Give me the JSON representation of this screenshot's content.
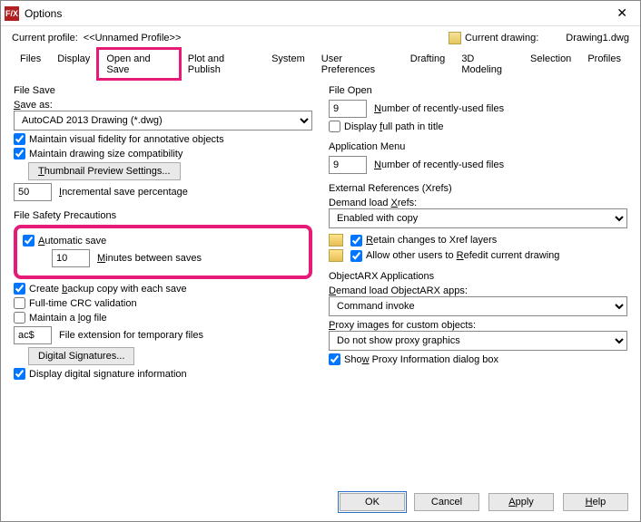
{
  "window": {
    "title": "Options",
    "appIcon": "F/X"
  },
  "profile": {
    "label": "Current profile:",
    "value": "<<Unnamed Profile>>",
    "drawingLabel": "Current drawing:",
    "drawingValue": "Drawing1.dwg"
  },
  "tabs": [
    "Files",
    "Display",
    "Open and Save",
    "Plot and Publish",
    "System",
    "User Preferences",
    "Drafting",
    "3D Modeling",
    "Selection",
    "Profiles"
  ],
  "activeTab": "Open and Save",
  "left": {
    "fileSave": {
      "title": "File Save",
      "saveAsLabel": "Save as:",
      "saveAsValue": "AutoCAD 2013 Drawing (*.dwg)",
      "maintainVisual": "Maintain visual fidelity for annotative objects",
      "maintainCompat": "Maintain drawing size compatibility",
      "thumbBtn": "Thumbnail Preview Settings...",
      "incSaveValue": "50",
      "incSaveLabel": "Incremental save percentage"
    },
    "safety": {
      "title": "File Safety Precautions",
      "autoSave": "Automatic save",
      "minutesValue": "10",
      "minutesLabel": "Minutes between saves",
      "backup": "Create backup copy with each save",
      "crc": "Full-time CRC validation",
      "logfile": "Maintain a log file",
      "extValue": "ac$",
      "extLabel": "File extension for temporary files",
      "digSigBtn": "Digital Signatures...",
      "dispSig": "Display digital signature information"
    }
  },
  "right": {
    "fileOpen": {
      "title": "File Open",
      "numValue": "9",
      "numLabel": "Number of recently-used files",
      "fullPath": "Display full path in title"
    },
    "appMenu": {
      "title": "Application Menu",
      "numValue": "9",
      "numLabel": "Number of recently-used files"
    },
    "xrefs": {
      "title": "External References (Xrefs)",
      "demandLabel": "Demand load Xrefs:",
      "demandValue": "Enabled with copy",
      "retain": "Retain changes to Xref layers",
      "allowOthers": "Allow other users to Refedit current drawing"
    },
    "arx": {
      "title": "ObjectARX Applications",
      "demandLabel": "Demand load ObjectARX apps:",
      "demandValue": "Command invoke",
      "proxyLabel": "Proxy images for custom objects:",
      "proxyValue": "Do not show proxy graphics",
      "showProxy": "Show Proxy Information dialog box"
    }
  },
  "footer": {
    "ok": "OK",
    "cancel": "Cancel",
    "apply": "Apply",
    "help": "Help"
  }
}
